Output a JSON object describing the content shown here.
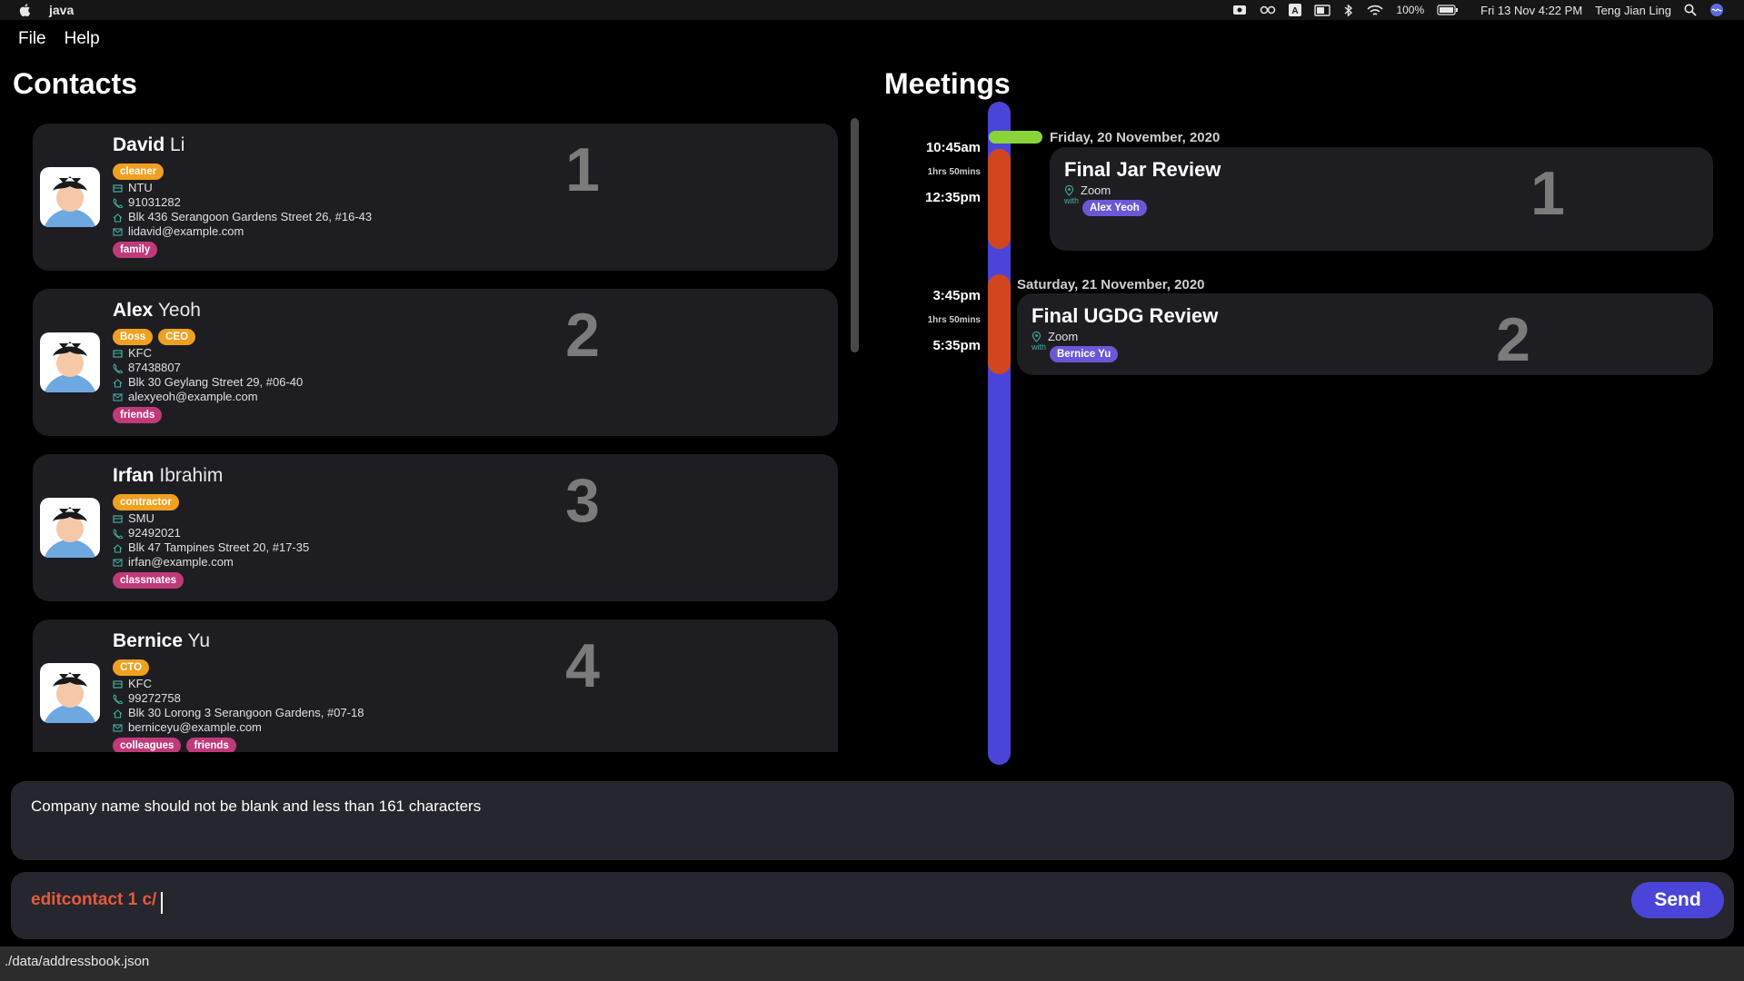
{
  "mac_menu_bar": {
    "app_name": "java",
    "battery": "100%",
    "datetime": "Fri 13 Nov  4:22 PM",
    "user": "Teng Jian Ling"
  },
  "app_menu": {
    "file": "File",
    "help": "Help"
  },
  "contacts": {
    "title": "Contacts",
    "items": [
      {
        "first": "David",
        "last": "Li",
        "index": "1",
        "roles": [
          "cleaner"
        ],
        "company": "NTU",
        "phone": "91031282",
        "address": "Blk 436 Serangoon Gardens Street 26, #16-43",
        "email": "lidavid@example.com",
        "tags": [
          "family"
        ]
      },
      {
        "first": "Alex",
        "last": "Yeoh",
        "index": "2",
        "roles": [
          "Boss",
          "CEO"
        ],
        "company": "KFC",
        "phone": "87438807",
        "address": "Blk 30 Geylang Street 29, #06-40",
        "email": "alexyeoh@example.com",
        "tags": [
          "friends"
        ]
      },
      {
        "first": "Irfan",
        "last": "Ibrahim",
        "index": "3",
        "roles": [
          "contractor"
        ],
        "company": "SMU",
        "phone": "92492021",
        "address": "Blk 47 Tampines Street 20, #17-35",
        "email": "irfan@example.com",
        "tags": [
          "classmates"
        ]
      },
      {
        "first": "Bernice",
        "last": "Yu",
        "index": "4",
        "roles": [
          "CTO"
        ],
        "company": "KFC",
        "phone": "99272758",
        "address": "Blk 30 Lorong 3 Serangoon Gardens, #07-18",
        "email": "berniceyu@example.com",
        "tags": [
          "colleagues",
          "friends"
        ]
      }
    ]
  },
  "meetings": {
    "title": "Meetings",
    "items": [
      {
        "date": "Friday, 20 November, 2020",
        "start": "10:45am",
        "duration": "1hrs 50mins",
        "end": "12:35pm",
        "name": "Final Jar Review",
        "location": "Zoom",
        "with_label": "with",
        "person": "Alex Yeoh",
        "index": "1"
      },
      {
        "date": "Saturday, 21 November, 2020",
        "start": "3:45pm",
        "duration": "1hrs 50mins",
        "end": "5:35pm",
        "name": "Final UGDG Review",
        "location": "Zoom",
        "with_label": "with",
        "person": "Bernice Yu",
        "index": "2"
      }
    ]
  },
  "result": {
    "message": "Company name should not be blank and less than 161 characters"
  },
  "command": {
    "value": "editcontact 1 c/",
    "send_label": "Send"
  },
  "status_bar": {
    "path": "./data/addressbook.json"
  }
}
